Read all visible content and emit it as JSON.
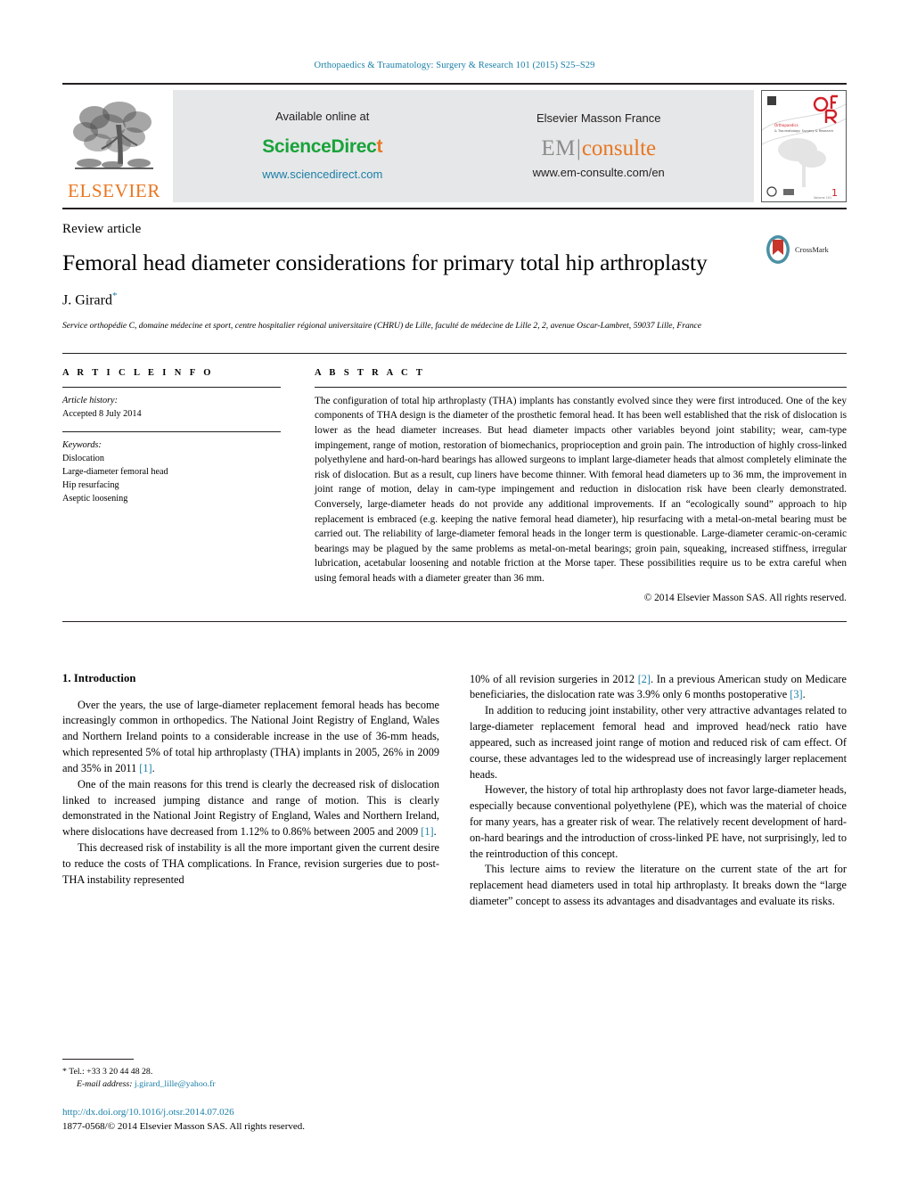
{
  "running_head": "Orthopaedics & Traumatology: Surgery & Research 101 (2015) S25–S29",
  "banner": {
    "publisher_logo_text": "ELSEVIER",
    "available_online_label": "Available online at",
    "sciencedirect_part1": "ScienceDirec",
    "sciencedirect_part2": "t",
    "sciencedirect_url": "www.sciencedirect.com",
    "masson_label": "Elsevier Masson France",
    "em_part": "EM",
    "em_divider": "|",
    "consulte_part": "consulte",
    "emconsulte_url": "www.em-consulte.com/en",
    "cover_journal_initials": "OTSR",
    "cover_caption": "Orthopaedics & Traumatology: Surgery & Research",
    "cover_issue": "1"
  },
  "article": {
    "type": "Review article",
    "title": "Femoral head diameter considerations for primary total hip arthroplasty",
    "author": "J. Girard",
    "author_marker": "*",
    "affiliation": "Service orthopédie C, domaine médecine et sport, centre hospitalier régional universitaire (CHRU) de Lille, faculté de médecine de Lille 2, 2, avenue Oscar-Lambret, 59037 Lille, France",
    "crossmark_label": "CrossMark"
  },
  "info": {
    "heading": "A R T I C L E   I N F O",
    "history_label": "Article history:",
    "history_value": "Accepted 8 July 2014",
    "keywords_label": "Keywords:",
    "keywords": [
      "Dislocation",
      "Large-diameter femoral head",
      "Hip resurfacing",
      "Aseptic loosening"
    ]
  },
  "abstract": {
    "heading": "A B S T R A C T",
    "text": "The configuration of total hip arthroplasty (THA) implants has constantly evolved since they were first introduced. One of the key components of THA design is the diameter of the prosthetic femoral head. It has been well established that the risk of dislocation is lower as the head diameter increases. But head diameter impacts other variables beyond joint stability; wear, cam-type impingement, range of motion, restoration of biomechanics, proprioception and groin pain. The introduction of highly cross-linked polyethylene and hard-on-hard bearings has allowed surgeons to implant large-diameter heads that almost completely eliminate the risk of dislocation. But as a result, cup liners have become thinner. With femoral head diameters up to 36 mm, the improvement in joint range of motion, delay in cam-type impingement and reduction in dislocation risk have been clearly demonstrated. Conversely, large-diameter heads do not provide any additional improvements. If an “ecologically sound” approach to hip replacement is embraced (e.g. keeping the native femoral head diameter), hip resurfacing with a metal-on-metal bearing must be carried out. The reliability of large-diameter femoral heads in the longer term is questionable. Large-diameter ceramic-on-ceramic bearings may be plagued by the same problems as metal-on-metal bearings; groin pain, squeaking, increased stiffness, irregular lubrication, acetabular loosening and notable friction at the Morse taper. These possibilities require us to be extra careful when using femoral heads with a diameter greater than 36 mm.",
    "copyright": "© 2014 Elsevier Masson SAS. All rights reserved."
  },
  "intro": {
    "heading": "1.  Introduction",
    "p1_a": "Over the years, the use of large-diameter replacement femoral heads has become increasingly common in orthopedics. The National Joint Registry of England, Wales and Northern Ireland points to a considerable increase in the use of 36-mm heads, which represented 5% of total hip arthroplasty (THA) implants in 2005, 26% in 2009 and 35% in 2011 ",
    "p1_ref": "[1]",
    "p1_b": ".",
    "p2_a": "One of the main reasons for this trend is clearly the decreased risk of dislocation linked to increased jumping distance and range of motion. This is clearly demonstrated in the National Joint Registry of England, Wales and Northern Ireland, where dislocations have decreased from 1.12% to 0.86% between 2005 and 2009 ",
    "p2_ref": "[1]",
    "p2_b": ".",
    "p3": "This decreased risk of instability is all the more important given the current desire to reduce the costs of THA complications. In France, revision surgeries due to post-THA instability represented",
    "p4_a": "10% of all revision surgeries in 2012 ",
    "p4_ref1": "[2]",
    "p4_b": ". In a previous American study on Medicare beneficiaries, the dislocation rate was 3.9% only 6 months postoperative ",
    "p4_ref2": "[3]",
    "p4_c": ".",
    "p5": "In addition to reducing joint instability, other very attractive advantages related to large-diameter replacement femoral head and improved head/neck ratio have appeared, such as increased joint range of motion and reduced risk of cam effect. Of course, these advantages led to the widespread use of increasingly larger replacement heads.",
    "p6": "However, the history of total hip arthroplasty does not favor large-diameter heads, especially because conventional polyethylene (PE), which was the material of choice for many years, has a greater risk of wear. The relatively recent development of hard-on-hard bearings and the introduction of cross-linked PE have, not surprisingly, led to the reintroduction of this concept.",
    "p7": "This lecture aims to review the literature on the current state of the art for replacement head diameters used in total hip arthroplasty. It breaks down the “large diameter” concept to assess its advantages and disadvantages and evaluate its risks."
  },
  "footnote": {
    "marker": "*",
    "tel": "Tel.: +33 3 20 44 48 28.",
    "email_label": "E-mail address:",
    "email": "j.girard_lille@yahoo.fr"
  },
  "doc_footer": {
    "doi": "http://dx.doi.org/10.1016/j.otsr.2014.07.026",
    "issn": "1877-0568/© 2014 Elsevier Masson SAS. All rights reserved."
  },
  "colors": {
    "link": "#1a7fa8",
    "elsevier_orange": "#e87722",
    "sciencedirect_green": "#18a33a",
    "em_gray": "#8c8c8c",
    "banner_bg": "#e6e7e8"
  }
}
